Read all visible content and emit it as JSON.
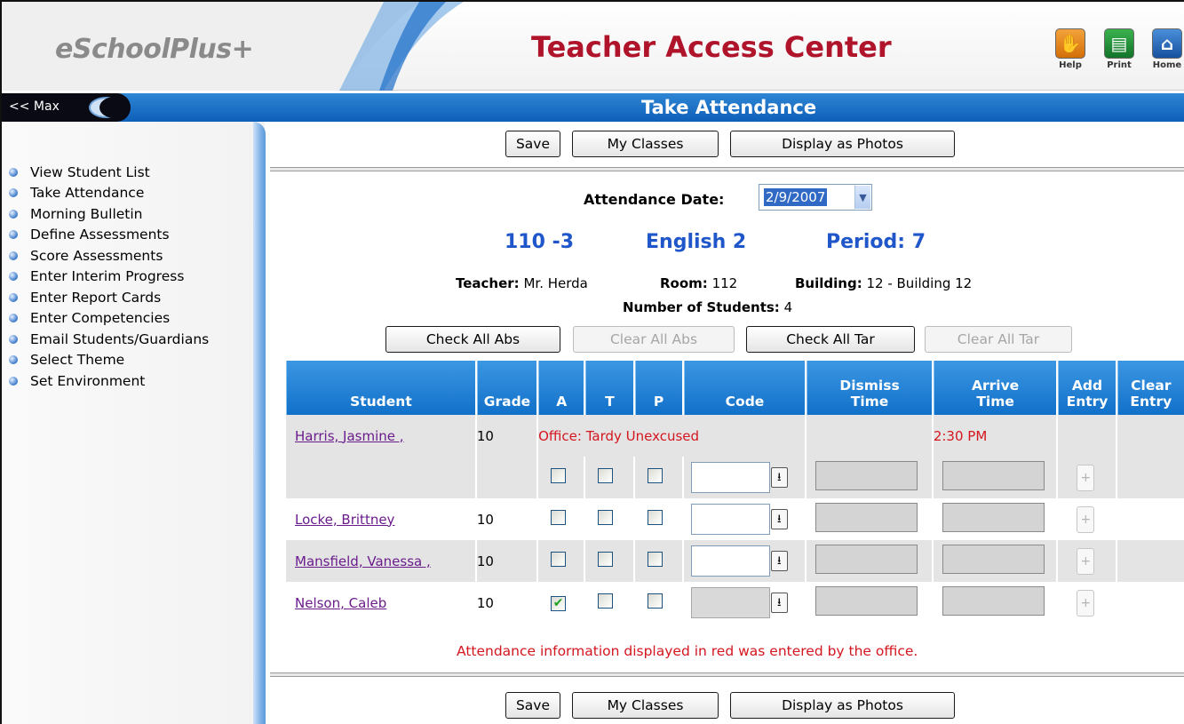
{
  "header": {
    "logo": "eSchoolPlus+",
    "title": "Teacher Access Center",
    "buttons": [
      {
        "label": "Help",
        "icon": "hand-icon",
        "color": "#e07b12"
      },
      {
        "label": "Print",
        "icon": "printer-icon",
        "color": "#1c8a2e"
      },
      {
        "label": "Home",
        "icon": "home-icon",
        "color": "#1d5fb0"
      }
    ]
  },
  "bar": {
    "max_link": "<< Max",
    "page_title": "Take Attendance"
  },
  "sidebar": {
    "items": [
      {
        "label": "View Student List"
      },
      {
        "label": "Take Attendance"
      },
      {
        "label": "Morning Bulletin"
      },
      {
        "label": "Define Assessments"
      },
      {
        "label": "Score Assessments"
      },
      {
        "label": "Enter Interim Progress"
      },
      {
        "label": "Enter Report Cards"
      },
      {
        "label": "Enter Competencies"
      },
      {
        "label": "Email Students/Guardians"
      },
      {
        "label": "Select Theme"
      },
      {
        "label": "Set Environment"
      }
    ]
  },
  "actions": {
    "save": "Save",
    "my_classes": "My Classes",
    "display_photos": "Display as Photos"
  },
  "attendance": {
    "date_label": "Attendance Date:",
    "date_value": "2/9/2007"
  },
  "class_info": {
    "section": "110 -3",
    "course": "English 2",
    "period": "Period: 7",
    "teacher_label": "Teacher:",
    "teacher": "Mr. Herda",
    "room_label": "Room:",
    "room": "112",
    "building_label": "Building:",
    "building": "12 - Building 12",
    "students_label": "Number of Students:",
    "students": "4"
  },
  "bulk": {
    "check_abs": "Check All Abs",
    "clear_abs": "Clear All Abs",
    "check_tar": "Check All Tar",
    "clear_tar": "Clear All Tar"
  },
  "table": {
    "headers": {
      "student": "Student",
      "grade": "Grade",
      "a": "A",
      "t": "T",
      "p": "P",
      "code": "Code",
      "dismiss_1": "Dismiss",
      "dismiss_2": "Time",
      "arrive_1": "Arrive",
      "arrive_2": "Time",
      "add_1": "Add",
      "add_2": "Entry",
      "clear_1": "Clear",
      "clear_2": "Entry"
    },
    "rows": [
      {
        "name": "Harris, Jasmine ,",
        "grade": "10",
        "office_entry": "Office: Tardy Unexcused",
        "office_time": "2:30 PM"
      },
      {
        "name": "Locke, Brittney",
        "grade": "10",
        "absent_checked": false
      },
      {
        "name": "Mansfield, Vanessa ,",
        "grade": "10",
        "absent_checked": false
      },
      {
        "name": "Nelson, Caleb",
        "grade": "10",
        "absent_checked": true
      }
    ],
    "add_symbol": "+",
    "dropdown_symbol": "⭳",
    "check_symbol": "✔"
  },
  "note": "Attendance information displayed in red was entered by the office."
}
